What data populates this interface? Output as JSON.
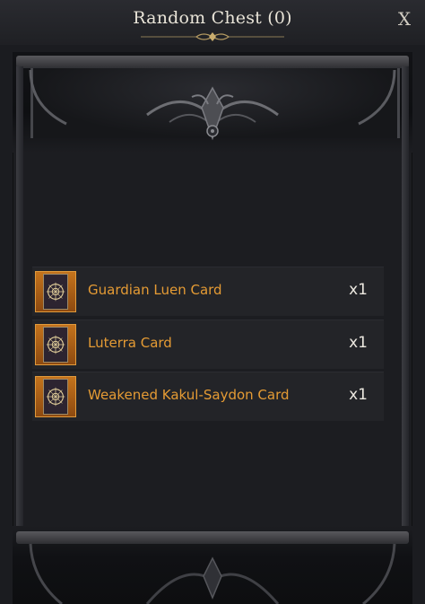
{
  "window": {
    "title": "Random Chest (0)",
    "close_label": "X"
  },
  "items": [
    {
      "name": "Guardian Luen Card",
      "quantity": "x1",
      "icon": "card-icon"
    },
    {
      "name": "Luterra Card",
      "quantity": "x1",
      "icon": "card-icon"
    },
    {
      "name": "Weakened Kakul-Saydon Card",
      "quantity": "x1",
      "icon": "card-icon"
    }
  ],
  "colors": {
    "item_name": "#e59b34",
    "slot_orange": "#c4731c",
    "background": "#1b1c20",
    "title_text": "#e9e4d8"
  }
}
